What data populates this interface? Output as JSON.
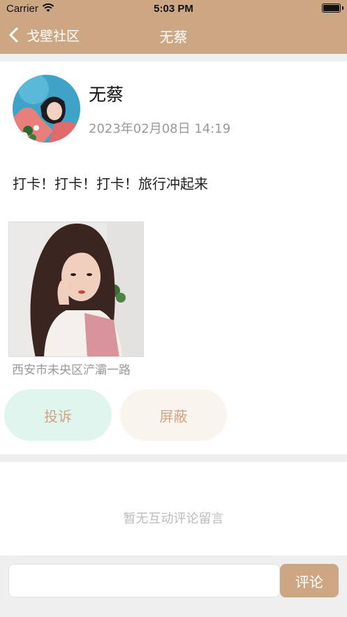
{
  "status_bar": {
    "carrier": "Carrier",
    "time": "5:03 PM"
  },
  "nav": {
    "back_label": "戈壁社区",
    "title": "无蔡"
  },
  "post": {
    "author": "无蔡",
    "timestamp": "2023年02月08日  14:19",
    "text": "打卡！打卡！打卡！旅行冲起来",
    "location": "西安市未央区浐灞一路"
  },
  "actions": {
    "complain_label": "投诉",
    "block_label": "屏蔽"
  },
  "comments": {
    "empty_text": "暂无互动评论留言"
  },
  "composer": {
    "input_value": "",
    "send_label": "评论"
  },
  "colors": {
    "accent": "#cda783",
    "complain_bg": "#e1f5ef",
    "block_bg": "#faf4ee"
  }
}
